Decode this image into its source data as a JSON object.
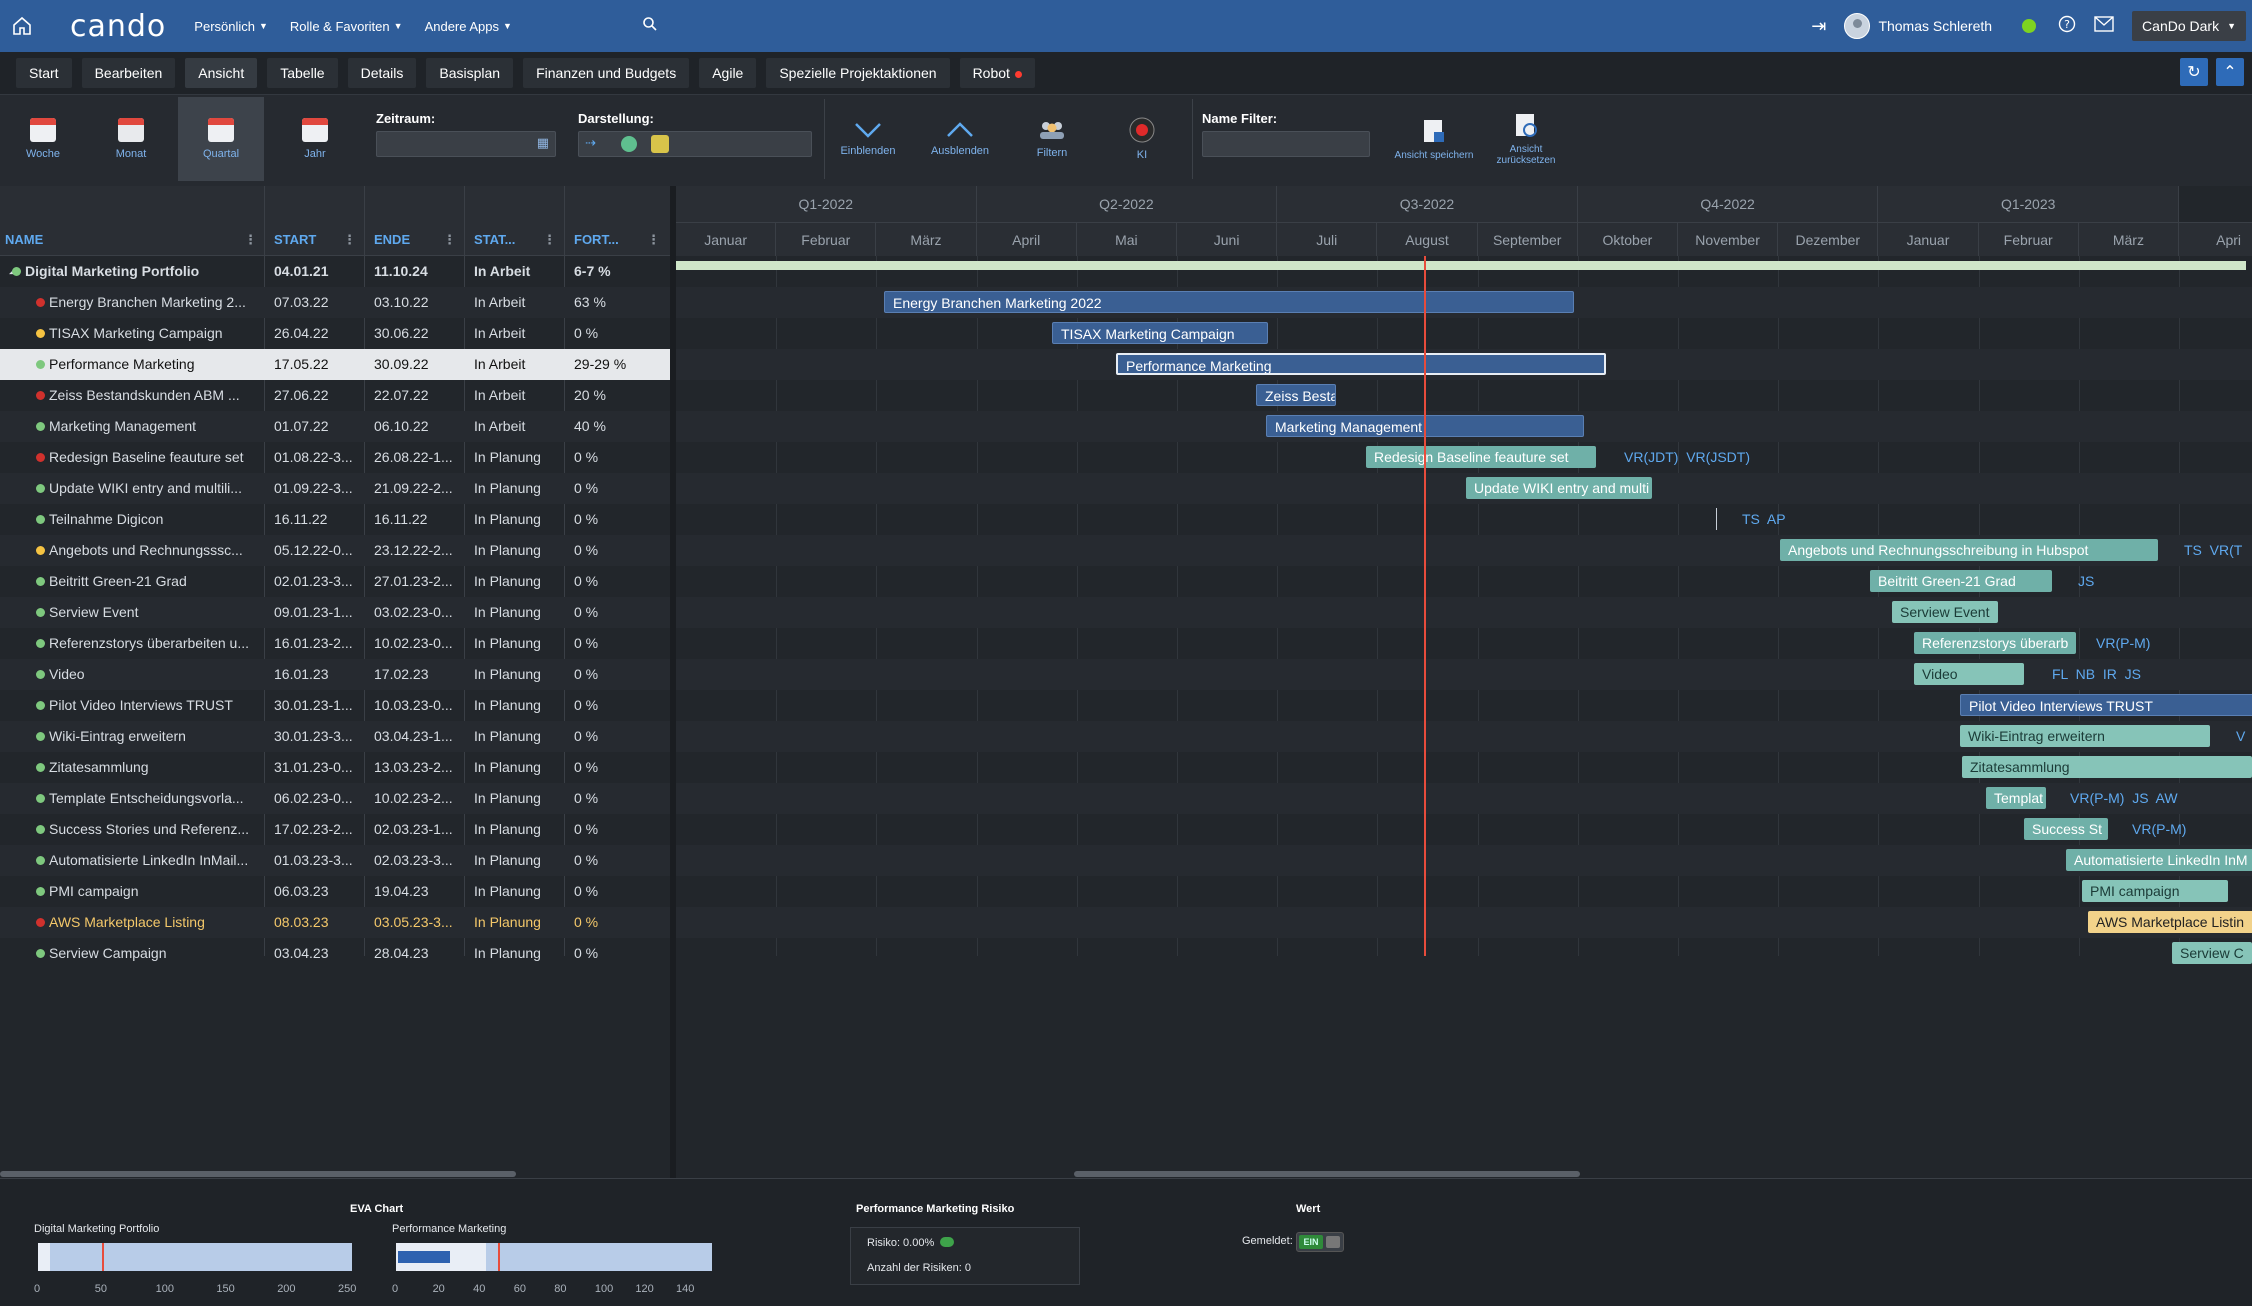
{
  "topbar": {
    "logo": "cando",
    "menus": [
      "Persönlich",
      "Rolle & Favoriten",
      "Andere Apps"
    ],
    "user": "Thomas Schlereth",
    "theme": "CanDo Dark"
  },
  "tabs": [
    "Start",
    "Bearbeiten",
    "Ansicht",
    "Tabelle",
    "Details",
    "Basisplan",
    "Finanzen und Budgets",
    "Agile",
    "Spezielle Projektaktionen",
    "Robot"
  ],
  "ribbon": {
    "views": [
      "Woche",
      "Monat",
      "Quartal",
      "Jahr"
    ],
    "zeitraum_label": "Zeitraum:",
    "darstellung_label": "Darstellung:",
    "actions": [
      "Einblenden",
      "Ausblenden",
      "Filtern",
      "KI"
    ],
    "name_filter_label": "Name Filter:",
    "save_view": "Ansicht speichern",
    "reset_view": "Ansicht zurücksetzen"
  },
  "grid": {
    "columns": [
      "NAME",
      "START",
      "ENDE",
      "STAT...",
      "FORT..."
    ],
    "rows": [
      {
        "name": "Digital Marketing Portfolio",
        "start": "04.01.21",
        "end": "11.10.24",
        "status": "In Arbeit",
        "progress": "6-7 %",
        "dot": "#7ec87e"
      },
      {
        "name": "Energy Branchen Marketing 2...",
        "start": "07.03.22",
        "end": "03.10.22",
        "status": "In Arbeit",
        "progress": "63 %",
        "dot": "#d0312d"
      },
      {
        "name": "TISAX Marketing Campaign",
        "start": "26.04.22",
        "end": "30.06.22",
        "status": "In Arbeit",
        "progress": "0 %",
        "dot": "#f5c342"
      },
      {
        "name": "Performance Marketing",
        "start": "17.05.22",
        "end": "30.09.22",
        "status": "In Arbeit",
        "progress": "29-29 %",
        "dot": "#7ec87e"
      },
      {
        "name": "Zeiss Bestandskunden ABM ...",
        "start": "27.06.22",
        "end": "22.07.22",
        "status": "In Arbeit",
        "progress": "20 %",
        "dot": "#d0312d"
      },
      {
        "name": "Marketing Management",
        "start": "01.07.22",
        "end": "06.10.22",
        "status": "In Arbeit",
        "progress": "40 %",
        "dot": "#7ec87e"
      },
      {
        "name": "Redesign Baseline feauture set",
        "start": "01.08.22-3...",
        "end": "26.08.22-1...",
        "status": "In Planung",
        "progress": "0 %",
        "dot": "#d0312d"
      },
      {
        "name": "Update WIKI entry and multili...",
        "start": "01.09.22-3...",
        "end": "21.09.22-2...",
        "status": "In Planung",
        "progress": "0 %",
        "dot": "#7ec87e"
      },
      {
        "name": "Teilnahme Digicon",
        "start": "16.11.22",
        "end": "16.11.22",
        "status": "In Planung",
        "progress": "0 %",
        "dot": "#7ec87e"
      },
      {
        "name": "Angebots und Rechnungsssc...",
        "start": "05.12.22-0...",
        "end": "23.12.22-2...",
        "status": "In Planung",
        "progress": "0 %",
        "dot": "#f5c342"
      },
      {
        "name": "Beitritt Green-21 Grad",
        "start": "02.01.23-3...",
        "end": "27.01.23-2...",
        "status": "In Planung",
        "progress": "0 %",
        "dot": "#7ec87e"
      },
      {
        "name": "Serview Event",
        "start": "09.01.23-1...",
        "end": "03.02.23-0...",
        "status": "In Planung",
        "progress": "0 %",
        "dot": "#7ec87e"
      },
      {
        "name": "Referenzstorys überarbeiten u...",
        "start": "16.01.23-2...",
        "end": "10.02.23-0...",
        "status": "In Planung",
        "progress": "0 %",
        "dot": "#7ec87e"
      },
      {
        "name": "Video",
        "start": "16.01.23",
        "end": "17.02.23",
        "status": "In Planung",
        "progress": "0 %",
        "dot": "#7ec87e"
      },
      {
        "name": "Pilot Video Interviews TRUST",
        "start": "30.01.23-1...",
        "end": "10.03.23-0...",
        "status": "In Planung",
        "progress": "0 %",
        "dot": "#7ec87e"
      },
      {
        "name": "Wiki-Eintrag erweitern",
        "start": "30.01.23-3...",
        "end": "03.04.23-1...",
        "status": "In Planung",
        "progress": "0 %",
        "dot": "#7ec87e"
      },
      {
        "name": "Zitatesammlung",
        "start": "31.01.23-0...",
        "end": "13.03.23-2...",
        "status": "In Planung",
        "progress": "0 %",
        "dot": "#7ec87e"
      },
      {
        "name": "Template Entscheidungsvorla...",
        "start": "06.02.23-0...",
        "end": "10.02.23-2...",
        "status": "In Planung",
        "progress": "0 %",
        "dot": "#7ec87e"
      },
      {
        "name": "Success Stories und Referenz...",
        "start": "17.02.23-2...",
        "end": "02.03.23-1...",
        "status": "In Planung",
        "progress": "0 %",
        "dot": "#7ec87e"
      },
      {
        "name": "Automatisierte LinkedIn InMail...",
        "start": "01.03.23-3...",
        "end": "02.03.23-3...",
        "status": "In Planung",
        "progress": "0 %",
        "dot": "#7ec87e"
      },
      {
        "name": "PMI campaign",
        "start": "06.03.23",
        "end": "19.04.23",
        "status": "In Planung",
        "progress": "0 %",
        "dot": "#7ec87e"
      },
      {
        "name": "AWS Marketplace Listing",
        "start": "08.03.23",
        "end": "03.05.23-3...",
        "status": "In Planung",
        "progress": "0 %",
        "dot": "#d0312d"
      },
      {
        "name": "Serview Campaign",
        "start": "03.04.23",
        "end": "28.04.23",
        "status": "In Planung",
        "progress": "0 %",
        "dot": "#7ec87e"
      }
    ]
  },
  "gantt": {
    "quarters": [
      "Q1-2022",
      "Q2-2022",
      "Q3-2022",
      "Q4-2022",
      "Q1-2023"
    ],
    "months": [
      "Januar",
      "Februar",
      "März",
      "April",
      "Mai",
      "Juni",
      "Juli",
      "August",
      "September",
      "Oktober",
      "November",
      "Dezember",
      "Januar",
      "Februar",
      "März",
      "Apri"
    ],
    "bars": [
      {
        "row": 1,
        "label": "Energy Branchen Marketing 2022"
      },
      {
        "row": 2,
        "label": "TISAX Marketing Campaign"
      },
      {
        "row": 3,
        "label": "Performance Marketing"
      },
      {
        "row": 4,
        "label": "Zeiss Besta"
      },
      {
        "row": 5,
        "label": "Marketing Management"
      },
      {
        "row": 6,
        "label": "Redesign Baseline feauture set"
      },
      {
        "row": 7,
        "label": "Update WIKI entry and multi"
      },
      {
        "row": 9,
        "label": "Angebots und Rechnungsschreibung in Hubspot"
      },
      {
        "row": 10,
        "label": "Beitritt Green-21 Grad"
      },
      {
        "row": 11,
        "label": "Serview Event"
      },
      {
        "row": 12,
        "label": "Referenzstorys überarb"
      },
      {
        "row": 13,
        "label": "Video"
      },
      {
        "row": 14,
        "label": "Pilot Video Interviews TRUST"
      },
      {
        "row": 15,
        "label": "Wiki-Eintrag erweitern"
      },
      {
        "row": 16,
        "label": "Zitatesammlung"
      },
      {
        "row": 17,
        "label": "Templat"
      },
      {
        "row": 18,
        "label": "Success St"
      },
      {
        "row": 19,
        "label": "Automatisierte LinkedIn InM"
      },
      {
        "row": 20,
        "label": "PMI campaign"
      },
      {
        "row": 21,
        "label": "AWS Marketplace Listin"
      },
      {
        "row": 22,
        "label": "Serview C"
      }
    ],
    "resources": [
      {
        "row": 6,
        "text": "VR(JDT)  VR(JSDT)"
      },
      {
        "row": 8,
        "text": "TS  AP"
      },
      {
        "row": 9,
        "text": "TS  VR(T"
      },
      {
        "row": 10,
        "text": "JS"
      },
      {
        "row": 12,
        "text": "VR(P-M)"
      },
      {
        "row": 13,
        "text": "FL  NB  IR  JS"
      },
      {
        "row": 15,
        "text": "V"
      },
      {
        "row": 17,
        "text": "VR(P-M)  JS  AW"
      },
      {
        "row": 18,
        "text": "VR(P-M)"
      }
    ]
  },
  "bottom": {
    "eva_title": "EVA Chart",
    "eva1_label": "Digital Marketing Portfolio",
    "eva1_ticks": [
      "0",
      "50",
      "100",
      "150",
      "200",
      "250"
    ],
    "eva2_label": "Performance Marketing",
    "eva2_ticks": [
      "0",
      "20",
      "40",
      "60",
      "80",
      "100",
      "120",
      "140"
    ],
    "risk_title": "Performance Marketing Risiko",
    "risk_value": "Risiko: 0.00%",
    "risk_count": "Anzahl der Risiken: 0",
    "wert_title": "Wert",
    "gemeldet_label": "Gemeldet:",
    "toggle": "EIN"
  }
}
